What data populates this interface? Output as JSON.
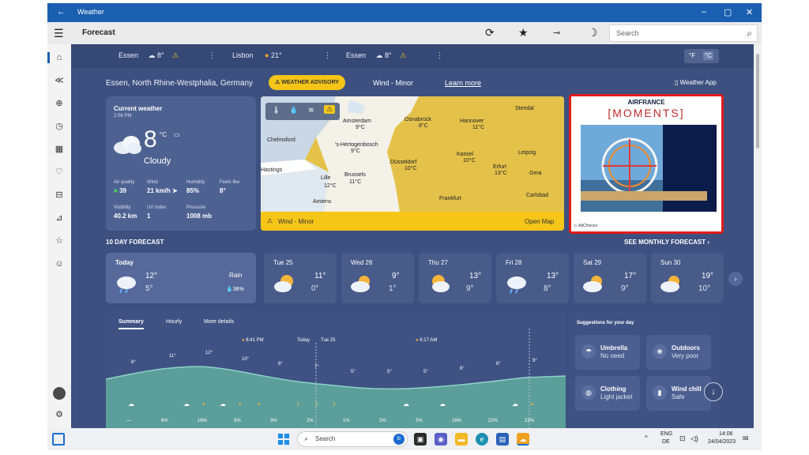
{
  "window": {
    "title": "Weather",
    "controls": [
      "–",
      "▢",
      "✕"
    ]
  },
  "toolbar": {
    "breadcrumb": "Forecast",
    "search_placeholder": "Search"
  },
  "locations_bar": [
    {
      "name": "Essen",
      "temp": "8°",
      "icon": "cloudy-icon",
      "alert": true
    },
    {
      "name": "Lisbon",
      "temp": "21°",
      "icon": "sunny-icon",
      "alert": false
    },
    {
      "name": "Essen",
      "temp": "8°",
      "icon": "cloudy-icon",
      "alert": true
    }
  ],
  "units": {
    "f": "°F",
    "c": "°C",
    "selected": "°C"
  },
  "header": {
    "location": "Essen, North Rhine-Westphalia, Germany",
    "advisory": "WEATHER ADVISORY",
    "advisory_detail": "Wind - Minor",
    "learn_more": "Learn more",
    "weather_app": "Weather App"
  },
  "current": {
    "label": "Current weather",
    "time": "2:06 PM",
    "temp": "8",
    "unit": "°C",
    "condition": "Cloudy",
    "stats": [
      {
        "label": "Air quality",
        "value": "39"
      },
      {
        "label": "Wind",
        "value": "21 km/h"
      },
      {
        "label": "Humidity",
        "value": "85%"
      },
      {
        "label": "Feels like",
        "value": "8°"
      },
      {
        "label": "Visibility",
        "value": "40.2 km"
      },
      {
        "label": "UV index",
        "value": "1"
      },
      {
        "label": "Pressure",
        "value": "1008 mb"
      }
    ]
  },
  "map": {
    "footer_alert": "Wind - Minor",
    "open_map": "Open Map",
    "cities": [
      {
        "name": "Amsterdam",
        "temp": "9°C"
      },
      {
        "name": "Osnabrück",
        "temp": "8°C"
      },
      {
        "name": "Hannover",
        "temp": "11°C"
      },
      {
        "name": "Stendal",
        "temp": ""
      },
      {
        "name": "Chelmsford",
        "temp": ""
      },
      {
        "name": "'s-Hertogenbosch",
        "temp": "9°C"
      },
      {
        "name": "Düsseldorf",
        "temp": "10°C"
      },
      {
        "name": "Kassel",
        "temp": "10°C"
      },
      {
        "name": "Leipzig",
        "temp": ""
      },
      {
        "name": "Erfurt",
        "temp": "13°C"
      },
      {
        "name": "Gera",
        "temp": ""
      },
      {
        "name": "Hastings",
        "temp": ""
      },
      {
        "name": "Lille",
        "temp": "12°C"
      },
      {
        "name": "Brussels",
        "temp": "11°C"
      },
      {
        "name": "Carlsbad",
        "temp": ""
      },
      {
        "name": "Amiens",
        "temp": ""
      },
      {
        "name": "Frankfurt",
        "temp": ""
      }
    ]
  },
  "ad": {
    "brand": "AIRFRANCE",
    "title": "[MOMENTS]",
    "adchoices": "AdChoices"
  },
  "forecast": {
    "title": "10 DAY FORECAST",
    "see_monthly": "SEE MONTHLY FORECAST",
    "days": [
      {
        "name": "Today",
        "hi": "12°",
        "lo": "5°",
        "icon": "rain-cloud-icon",
        "rain": "Rain",
        "rain_pct": "38%"
      },
      {
        "name": "Tue 25",
        "hi": "11°",
        "lo": "0°",
        "icon": "sun-cloud-icon"
      },
      {
        "name": "Wed 26",
        "hi": "9°",
        "lo": "1°",
        "icon": "sun-cloud-icon"
      },
      {
        "name": "Thu 27",
        "hi": "13°",
        "lo": "9°",
        "icon": "sun-cloud-icon"
      },
      {
        "name": "Fri 28",
        "hi": "13°",
        "lo": "8°",
        "icon": "rain-cloud-icon"
      },
      {
        "name": "Sat 29",
        "hi": "17°",
        "lo": "9°",
        "icon": "sun-cloud-icon"
      },
      {
        "name": "Sun 30",
        "hi": "19°",
        "lo": "10°",
        "icon": "sun-cloud-icon"
      }
    ]
  },
  "hourly": {
    "tabs": [
      "Summary",
      "Hourly",
      "More details"
    ],
    "sunset": "8:41 PM",
    "today": "Today",
    "tue": "Tue 25",
    "sunrise": "6:17 AM",
    "temps": [
      "8°",
      "11°",
      "12°",
      "10°",
      "8°",
      "7°",
      "5°",
      "5°",
      "5°",
      "6°",
      "8°",
      "9°"
    ],
    "precip": [
      "—",
      "6%",
      "16%",
      "9%",
      "3%",
      "2%",
      "1%",
      "2%",
      "3%",
      "16%",
      "22%",
      "22%"
    ]
  },
  "suggestions": {
    "title": "Suggestions for your day",
    "items": [
      {
        "icon": "umbrella-icon",
        "title": "Umbrella",
        "detail": "No need"
      },
      {
        "icon": "outdoors-icon",
        "title": "Outdoors",
        "detail": "Very poor"
      },
      {
        "icon": "clothing-icon",
        "title": "Clothing",
        "detail": "Light jacket"
      },
      {
        "icon": "thermometer-icon",
        "title": "Wind chill",
        "detail": "Safe"
      }
    ]
  },
  "taskbar": {
    "search": "Search",
    "lang1": "ENG",
    "lang2": "DE",
    "time": "14:06",
    "date": "24/04/2023"
  }
}
